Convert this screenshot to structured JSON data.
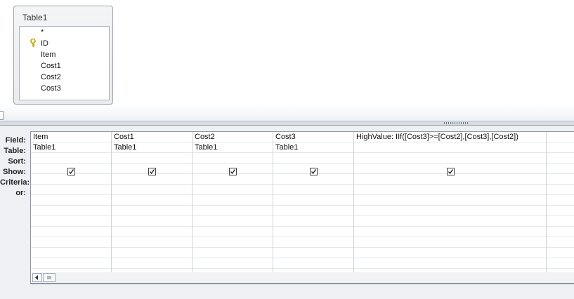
{
  "table": {
    "title": "Table1",
    "fields": [
      "*",
      "ID",
      "Item",
      "Cost1",
      "Cost2",
      "Cost3"
    ],
    "primary_key_field": "ID"
  },
  "grid": {
    "row_labels": [
      "Field:",
      "Table:",
      "Sort:",
      "Show:",
      "Criteria:",
      "or:"
    ],
    "columns": [
      {
        "field": "Item",
        "table": "Table1",
        "sort": "",
        "show": true,
        "criteria": "",
        "or": ""
      },
      {
        "field": "Cost1",
        "table": "Table1",
        "sort": "",
        "show": true,
        "criteria": "",
        "or": ""
      },
      {
        "field": "Cost2",
        "table": "Table1",
        "sort": "",
        "show": true,
        "criteria": "",
        "or": ""
      },
      {
        "field": "Cost3",
        "table": "Table1",
        "sort": "",
        "show": true,
        "criteria": "",
        "or": ""
      },
      {
        "field": "HighValue: IIf([Cost3]>=[Cost2],[Cost3],[Cost2])",
        "table": "",
        "sort": "",
        "show": true,
        "criteria": "",
        "or": ""
      },
      {
        "field": "",
        "table": "",
        "sort": "",
        "show": false,
        "criteria": "",
        "or": ""
      }
    ]
  },
  "icons": {
    "key": "key-icon",
    "checkbox_checked": "checkmark-icon",
    "scroll_left": "triangle-left-icon",
    "scroll_thumb": "grip-lines-icon"
  },
  "colors": {
    "key": "#c8a000",
    "border": "#8d97a3",
    "pane_bg": "#eef0f3"
  }
}
